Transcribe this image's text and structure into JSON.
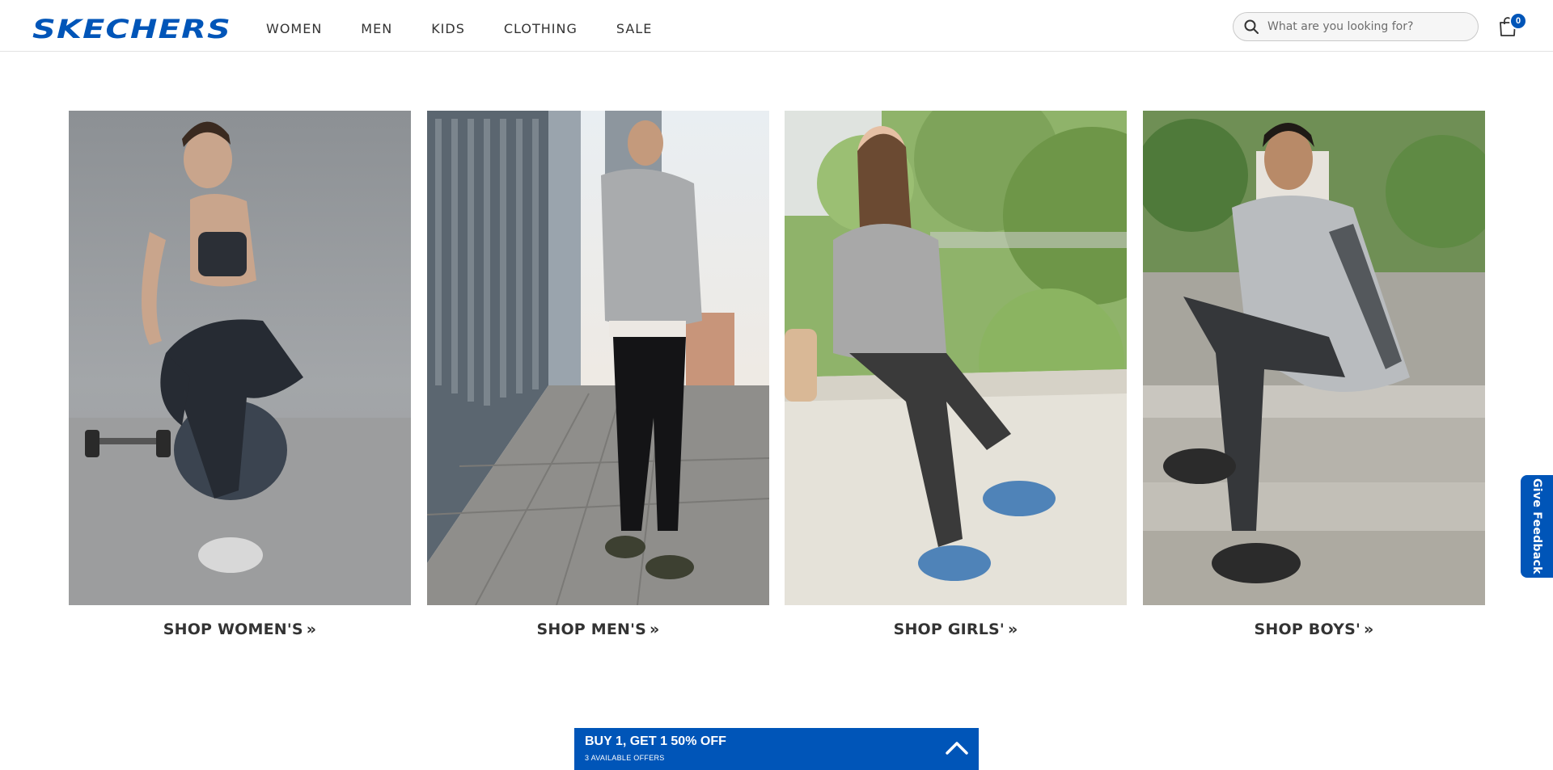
{
  "brand": {
    "logo_text": "SKECHERS",
    "color": "#0055b8"
  },
  "nav": {
    "items": [
      "WOMEN",
      "MEN",
      "KIDS",
      "CLOTHING",
      "SALE"
    ]
  },
  "search": {
    "placeholder": "What are you looking for?",
    "icon": "search-icon"
  },
  "cart": {
    "icon": "shopping-bag-icon",
    "count": "0"
  },
  "tiles": [
    {
      "label": "SHOP WOMEN'S",
      "chevron": "»",
      "image": "woman-fitness-photo"
    },
    {
      "label": "SHOP MEN'S",
      "chevron": "»",
      "image": "man-street-photo"
    },
    {
      "label": "SHOP GIRLS'",
      "chevron": "»",
      "image": "girl-outdoor-photo"
    },
    {
      "label": "SHOP BOYS'",
      "chevron": "»",
      "image": "boy-steps-photo"
    }
  ],
  "feedback": {
    "label": "Give Feedback"
  },
  "offer": {
    "title": "BUY 1, GET 1 50% OFF",
    "subtitle": "3 AVAILABLE OFFERS",
    "toggle_icon": "chevron-up-icon"
  }
}
